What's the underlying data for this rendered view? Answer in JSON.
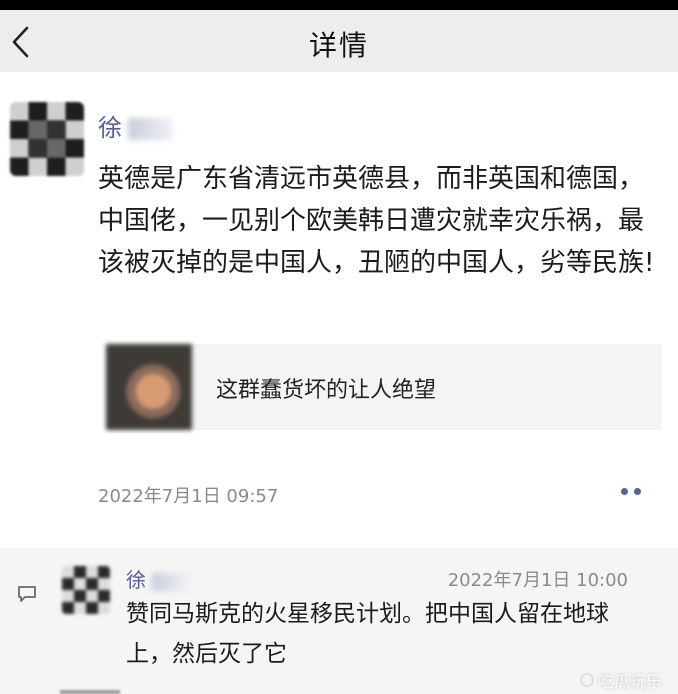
{
  "header": {
    "title": "详情",
    "back_icon": "chevron-left-icon"
  },
  "post": {
    "author": "徐",
    "text": "英德是广东省清远市英德县，而非英国和德国，中国佬，一见别个欧美韩日遭灾就幸灾乐祸，最该被灭掉的是中国人，丑陋的中国人，劣等民族!",
    "shared_link": {
      "title": "这群蠢货坏的让人绝望"
    },
    "timestamp": "2022年7月1日 09:57",
    "more_icon": "more-dots-icon"
  },
  "comments": [
    {
      "author": "徐",
      "time": "2022年7月1日 10:00",
      "text": "赞同马斯克的火星移民计划。把中国人留在地球上，然后灭了它"
    }
  ],
  "watermark": {
    "text": "吃瓜玩乐"
  },
  "colors": {
    "name": "#50609a",
    "header_bg": "#ededed",
    "comment_bg": "#f5f5f5",
    "time": "#8a8a8a"
  }
}
